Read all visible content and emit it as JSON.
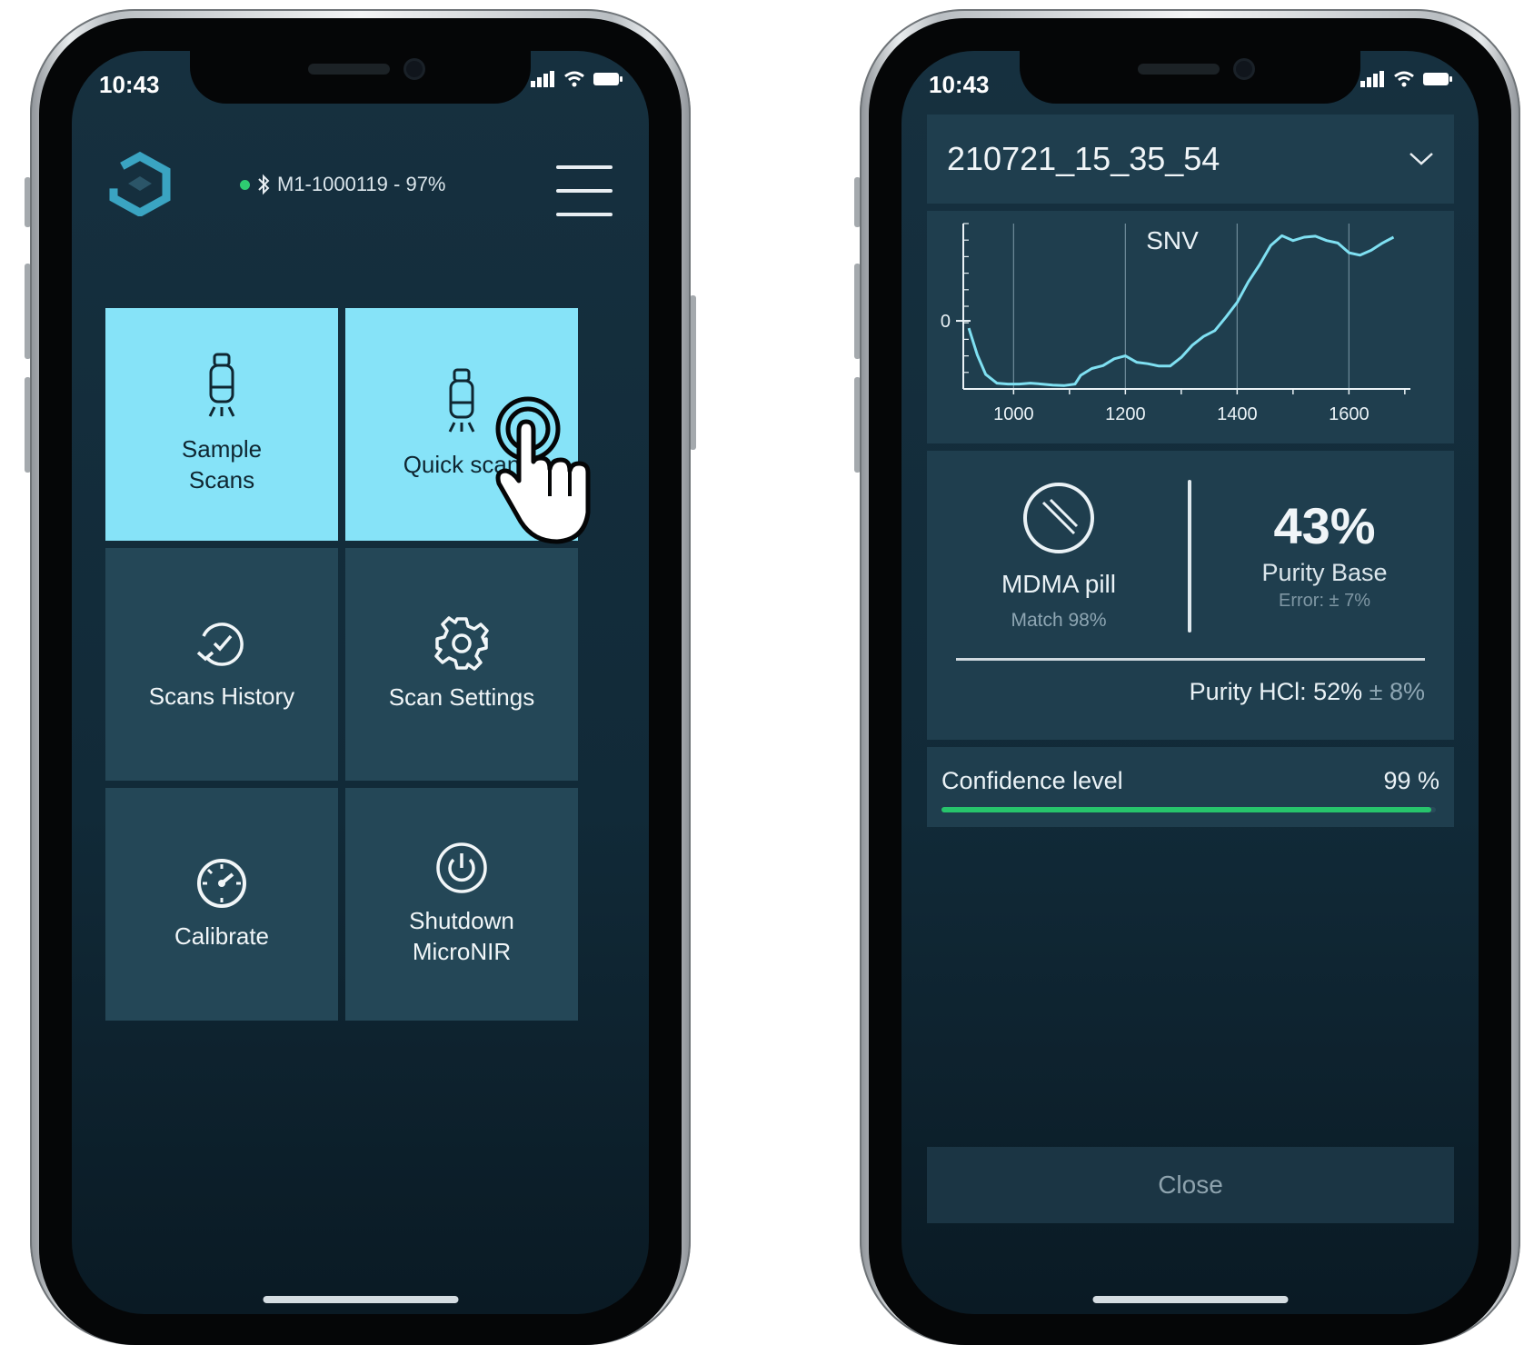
{
  "status_bar": {
    "time": "10:43"
  },
  "home": {
    "device": "M1-1000119  - 97%",
    "tiles": [
      {
        "label": "Sample\nScans",
        "icon": "scanner-icon",
        "active": true
      },
      {
        "label": "Quick scan",
        "icon": "scanner-icon",
        "active": true
      },
      {
        "label": "Scans History",
        "icon": "history-icon",
        "active": false
      },
      {
        "label": "Scan Settings",
        "icon": "gear-icon",
        "active": false
      },
      {
        "label": "Calibrate",
        "icon": "gauge-icon",
        "active": false
      },
      {
        "label": "Shutdown\nMicroNIR",
        "icon": "power-icon",
        "active": false
      }
    ]
  },
  "result": {
    "scan_id": "210721_15_35_54",
    "substance": "MDMA pill",
    "match": "Match 98%",
    "purity_base_value": "43%",
    "purity_base_label": "Purity Base",
    "purity_base_error": "Error: ± 7%",
    "purity_hcl": "Purity HCl: 52%",
    "purity_hcl_error": "± 8%",
    "confidence_label": "Confidence level",
    "confidence_value": "99 %",
    "confidence_fraction": 0.99,
    "close_label": "Close"
  },
  "colors": {
    "accent_tile": "#86e3f8",
    "tile": "#244757",
    "confidence_bar": "#27c46c",
    "status_connected": "#2ecc71"
  },
  "chart_data": {
    "type": "line",
    "title": "SNV",
    "xlabel": "",
    "ylabel": "",
    "x_ticks": [
      1000,
      1200,
      1400,
      1600
    ],
    "y_ticks": [
      0
    ],
    "xlim": [
      910,
      1710
    ],
    "ylim": [
      -1.4,
      2.0
    ],
    "grid": "vertical",
    "series": [
      {
        "x": [
          920,
          935,
          950,
          970,
          990,
          1010,
          1030,
          1050,
          1070,
          1090,
          1110,
          1120,
          1140,
          1160,
          1180,
          1200,
          1220,
          1240,
          1260,
          1280,
          1300,
          1320,
          1340,
          1360,
          1380,
          1400,
          1420,
          1440,
          1460,
          1480,
          1500,
          1520,
          1540,
          1560,
          1580,
          1600,
          1620,
          1640,
          1660,
          1680
        ],
        "y": [
          -0.15,
          -0.7,
          -1.1,
          -1.28,
          -1.3,
          -1.3,
          -1.28,
          -1.3,
          -1.32,
          -1.33,
          -1.3,
          -1.12,
          -0.98,
          -0.92,
          -0.78,
          -0.72,
          -0.85,
          -0.88,
          -0.93,
          -0.93,
          -0.75,
          -0.5,
          -0.32,
          -0.2,
          0.08,
          0.38,
          0.8,
          1.15,
          1.55,
          1.75,
          1.65,
          1.72,
          1.74,
          1.65,
          1.6,
          1.4,
          1.35,
          1.45,
          1.6,
          1.72
        ]
      }
    ]
  }
}
